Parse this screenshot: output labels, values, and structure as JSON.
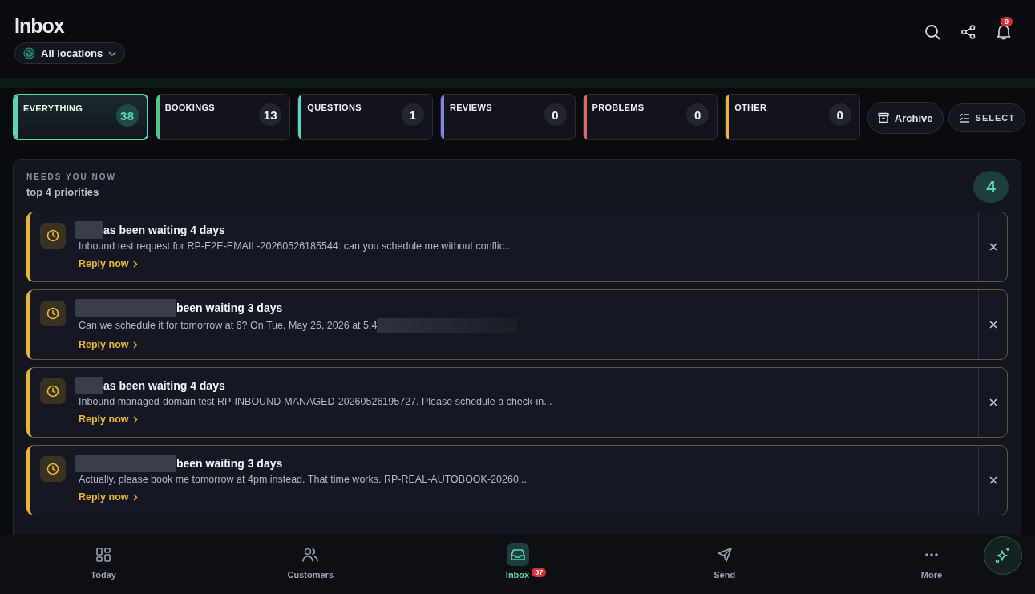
{
  "header": {
    "title": "Inbox",
    "location": "All locations",
    "notifications": "9"
  },
  "categories": [
    {
      "label": "EVERYTHING",
      "count": "38",
      "color": "#5fd4b8",
      "selected": true
    },
    {
      "label": "BOOKINGS",
      "count": "13",
      "color": "#4cc98a",
      "selected": false
    },
    {
      "label": "QUESTIONS",
      "count": "1",
      "color": "#5fd4c4",
      "selected": false
    },
    {
      "label": "REVIEWS",
      "count": "0",
      "color": "#7f86e0",
      "selected": false
    },
    {
      "label": "PROBLEMS",
      "count": "0",
      "color": "#e06a6a",
      "selected": false
    },
    {
      "label": "OTHER",
      "count": "0",
      "color": "#e8b53a",
      "selected": false
    }
  ],
  "actions": {
    "archive": "Archive",
    "select": "SELECT"
  },
  "priorities": {
    "eyebrow": "NEEDS YOU NOW",
    "subtitle": "top 4 priorities",
    "count": "4",
    "items": [
      {
        "title": "as been waiting 4 days",
        "message": "Inbound test request for RP-E2E-EMAIL-20260526185544: can you schedule me without conflic...",
        "action": "Reply now",
        "redacted_message": false
      },
      {
        "title": "been waiting 3 days",
        "message": "Can we schedule it for tomorrow at 6? On Tue, May 26, 2026 at 5:4",
        "action": "Reply now",
        "redacted_message": true
      },
      {
        "title": "as been waiting 4 days",
        "message": "Inbound managed-domain test RP-INBOUND-MANAGED-20260526195727. Please schedule a check-in...",
        "action": "Reply now",
        "redacted_message": false
      },
      {
        "title": "been waiting 3 days",
        "message": "Actually, please book me tomorrow at 4pm instead. That time works. RP-REAL-AUTOBOOK-20260...",
        "action": "Reply now",
        "redacted_message": false
      }
    ]
  },
  "nav": [
    {
      "kind": "grid",
      "label": "Today",
      "selected": false
    },
    {
      "kind": "people",
      "label": "Customers",
      "selected": false
    },
    {
      "kind": "inbox",
      "label": "Inbox",
      "selected": true,
      "badge": "37"
    },
    {
      "kind": "send",
      "label": "Send",
      "selected": false
    },
    {
      "kind": "more",
      "label": "More",
      "selected": false
    }
  ]
}
